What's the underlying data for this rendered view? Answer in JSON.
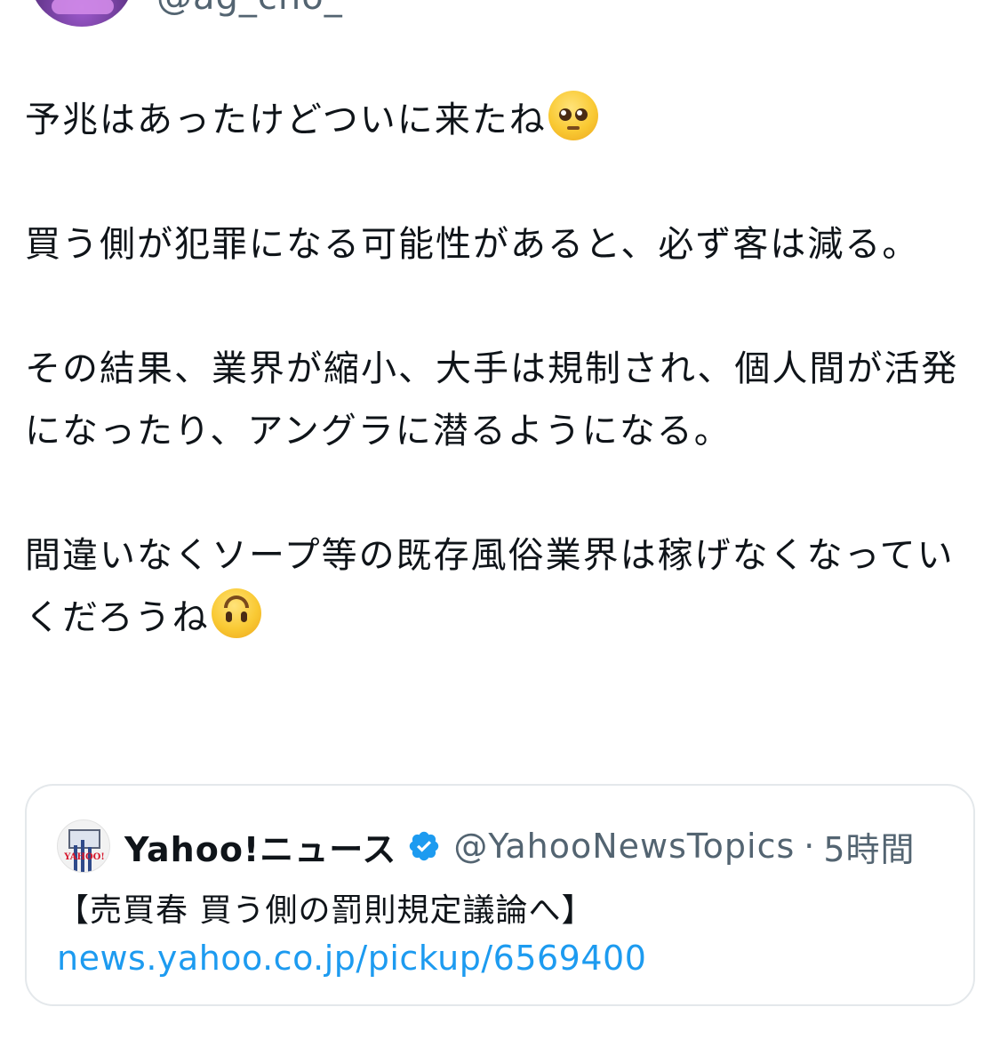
{
  "author": {
    "handle": "@ag_cho_",
    "avatar_icon": "user-avatar"
  },
  "tweet": {
    "paragraphs": [
      {
        "text": "予兆はあったけどついに来たね",
        "emoji": "pleading-face-emoji"
      },
      {
        "text": "買う側が犯罪になる可能性があると、必ず客は減る。",
        "emoji": ""
      },
      {
        "text": "その結果、業界が縮小、大手は規制され、個人間が活発になったり、アングラに潜るようになる。",
        "emoji": ""
      },
      {
        "text": "間違いなくソープ等の既存風俗業界は稼げなくなっていくだろうね",
        "emoji": "upside-down-face-emoji"
      }
    ]
  },
  "quote": {
    "name": "Yahoo!ニュース",
    "verified_icon": "verified-badge-icon",
    "handle": "@YahooNewsTopics",
    "separator": "·",
    "time": "5時間",
    "logo_text": "YAHOO!",
    "title": "【売買春 買う側の罰則規定議論へ】",
    "link": "news.yahoo.co.jp/pickup/6569400"
  },
  "colors": {
    "text": "#0f1419",
    "secondary": "#536471",
    "link": "#1d9bf0",
    "verified": "#1d9bf0",
    "card_border": "#e4e8eb"
  }
}
